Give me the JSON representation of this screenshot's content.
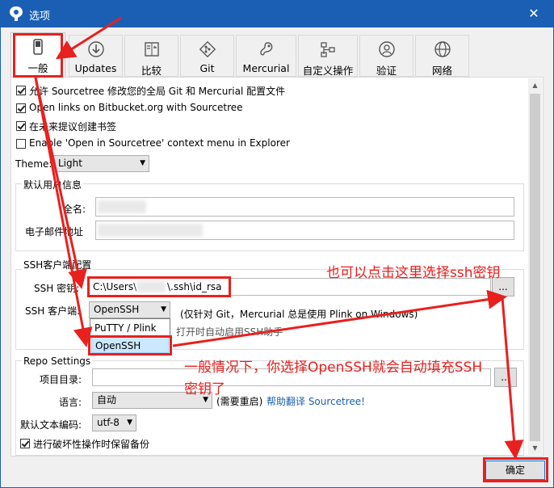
{
  "window": {
    "title": "选项",
    "close_glyph": "✕",
    "logo_icon": "sourcetree-logo"
  },
  "tabs": [
    {
      "label": "一般",
      "icon": "switch-icon",
      "active": true
    },
    {
      "label": "Updates",
      "icon": "download-icon"
    },
    {
      "label": "比较",
      "icon": "compare-icon"
    },
    {
      "label": "Git",
      "icon": "git-icon"
    },
    {
      "label": "Mercurial",
      "icon": "mercurial-icon"
    },
    {
      "label": "自定义操作",
      "icon": "custom-actions-icon"
    },
    {
      "label": "验证",
      "icon": "user-icon"
    },
    {
      "label": "网络",
      "icon": "globe-icon"
    }
  ],
  "general": {
    "options": [
      {
        "label": "允许 Sourcetree 修改您的全局 Git 和 Mercurial 配置文件",
        "checked": true
      },
      {
        "label": "Open links on Bitbucket.org with Sourcetree",
        "checked": true
      },
      {
        "label": "在未来提议创建书签",
        "checked": true
      },
      {
        "label": "Enable 'Open in Sourcetree' context menu in Explorer",
        "checked": false
      }
    ],
    "theme_label": "Theme:",
    "theme_value": "Light"
  },
  "user_info": {
    "group_title": "默认用户信息",
    "fullname_label": "全名:",
    "email_label": "电子邮件地址"
  },
  "ssh": {
    "group_title": "SSH客户端配置",
    "key_label": "SSH 密钥:",
    "key_value_prefix": "C:\\Users\\",
    "key_value_suffix": "\\.ssh\\id_rsa",
    "browse_label": "...",
    "client_label": "SSH 客户端:",
    "client_value": "OpenSSH",
    "client_note": "(仅针对 Git，Mercurial 总是使用 Plink on Windows)",
    "agent_text": "打开时自动启用SSH助手",
    "dropdown_options": [
      "PuTTY / Plink",
      "OpenSSH"
    ],
    "dropdown_selected": "OpenSSH"
  },
  "repo": {
    "group_title": "Repo Settings",
    "project_dir_label": "项目目录:",
    "browse_label": "...",
    "language_label": "语言:",
    "language_value": "自动",
    "restart_note": "(需要重启)",
    "help_translate": "帮助翻译 Sourcetree!",
    "encoding_label": "默认文本编码:",
    "encoding_value": "utf-8",
    "backup_label": "进行破坏性操作时保留备份",
    "backup_checked": true
  },
  "footer": {
    "ok_label": "确定"
  },
  "annotations": {
    "note1": "也可以点击这里选择ssh密钥",
    "note2_line1": "一般情况下，你选择OpenSSH就会自动填充SSH",
    "note2_line2": "密钥了",
    "color": "#e8201e"
  },
  "colors": {
    "titlebar": "#1a5fb4",
    "selection": "#cce8ff",
    "link": "#1a5fb4"
  }
}
